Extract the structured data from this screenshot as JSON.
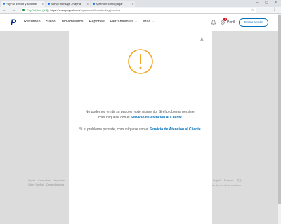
{
  "browser": {
    "tabs": [
      {
        "label": "PayPal: Enviar y solicitar"
      },
      {
        "label": "Nuevo mensaje - PayPal"
      },
      {
        "label": "Aprender cómo pagar"
      }
    ],
    "url_secure_label": "PayPal, Inc. [US]",
    "url_domain": "https://www.paypal.com",
    "url_path": "/myaccount/transfer/buy/preview"
  },
  "header": {
    "logo": "P",
    "nav": [
      "Resumen",
      "Saldo",
      "Movimientos",
      "Reportes",
      "Herramientas ⌄",
      "Más ⌄"
    ],
    "notification_count": "1",
    "profile_label": "Perfil",
    "logout_label": "Cerrar sesión"
  },
  "modal": {
    "msg1_text": "No podemos emitir su pago en este momento. Si el problema persiste, comuníquese con el",
    "msg1_link": "Servicio de Atención al Cliente",
    "msg2_text": "Si el problema persiste, comuníquese con el",
    "msg2_link": "Servicio de Atención al Cliente",
    "colors": {
      "warning": "#f5a623",
      "link": "#0070ba"
    }
  },
  "footer": {
    "left_row1": [
      "Ayuda",
      "Comunidad",
      "Seguridad"
    ],
    "left_row2": [
      "Sobre PayPal",
      "Desarrolladores"
    ],
    "right_row1": [
      "Español",
      "English",
      "Français",
      "中文"
    ],
    "right_row2": [
      "Condiciones de uso de los servicios"
    ]
  }
}
